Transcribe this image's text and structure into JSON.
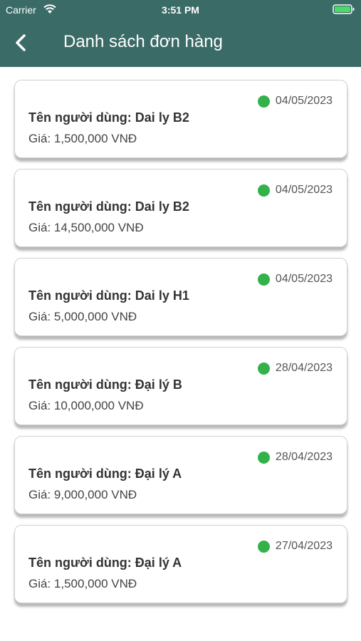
{
  "status_bar": {
    "carrier": "Carrier",
    "time": "3:51 PM"
  },
  "header": {
    "title": "Danh sách đơn hàng",
    "back_icon": "chevron-left-icon"
  },
  "colors": {
    "header_bg": "#3a6b66",
    "status_dot": "#33b249"
  },
  "orders": [
    {
      "user": "Tên người dùng: Dai ly B2",
      "price": "Giá: 1,500,000 VNĐ",
      "date": "04/05/2023"
    },
    {
      "user": "Tên người dùng: Dai ly B2",
      "price": "Giá: 14,500,000 VNĐ",
      "date": "04/05/2023"
    },
    {
      "user": "Tên người dùng: Dai ly H1",
      "price": "Giá: 5,000,000 VNĐ",
      "date": "04/05/2023"
    },
    {
      "user": "Tên người dùng: Đại lý B",
      "price": "Giá: 10,000,000 VNĐ",
      "date": "28/04/2023"
    },
    {
      "user": "Tên người dùng: Đại lý A",
      "price": "Giá: 9,000,000 VNĐ",
      "date": "28/04/2023"
    },
    {
      "user": "Tên người dùng: Đại lý A",
      "price": "Giá: 1,500,000 VNĐ",
      "date": "27/04/2023"
    }
  ]
}
